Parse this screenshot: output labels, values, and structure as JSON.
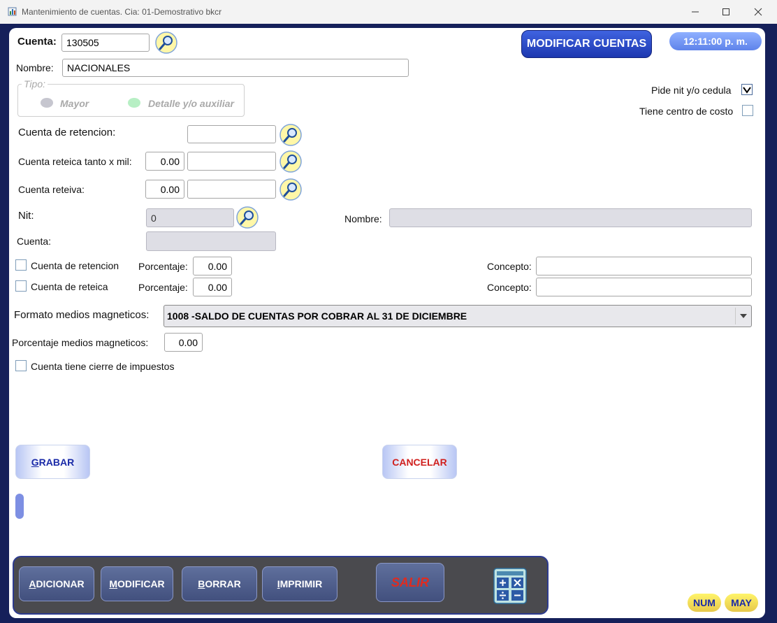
{
  "window": {
    "title": "Mantenimiento de cuentas.  Cia: 01-Demostrativo bkcr",
    "minimize_icon": "minimize-icon",
    "maximize_icon": "maximize-icon",
    "close_icon": "close-icon"
  },
  "header": {
    "mode_badge": "MODIFICAR CUENTAS",
    "clock": "12:11:00 p. m."
  },
  "cuenta": {
    "label": "Cuenta:",
    "value": "130505"
  },
  "nombre": {
    "label": "Nombre:",
    "value": "NACIONALES"
  },
  "tipo": {
    "legend": "Tipo:",
    "options": [
      {
        "label": "Mayor",
        "color": "#c6c6cf"
      },
      {
        "label": "Detalle y/o auxiliar",
        "color": "#b7efc4"
      }
    ]
  },
  "flags": {
    "pide_nit": {
      "label": "Pide nit y/o cedula",
      "checked": true
    },
    "centro_costo": {
      "label": "Tiene centro de costo",
      "checked": false
    }
  },
  "retenciones": {
    "cuenta_retencion": {
      "label": "Cuenta de retencion:",
      "value": ""
    },
    "cuenta_reteica": {
      "label": "Cuenta reteica tanto x mil:",
      "rate": "0.00",
      "value": ""
    },
    "cuenta_reteiva": {
      "label": "Cuenta reteiva:",
      "rate": "0.00",
      "value": ""
    }
  },
  "nit": {
    "label": "Nit:",
    "value": "0",
    "nombre_label": "Nombre:",
    "nombre_value": "",
    "cuenta_label": "Cuenta:",
    "cuenta_value": ""
  },
  "checks": {
    "retencion": {
      "label": "Cuenta de retencion",
      "pct_label": "Porcentaje:",
      "pct": "0.00",
      "concepto_label": "Concepto:",
      "concepto": ""
    },
    "reteica": {
      "label": "Cuenta de reteica",
      "pct_label": "Porcentaje:",
      "pct": "0.00",
      "concepto_label": "Concepto:",
      "concepto": ""
    }
  },
  "medios": {
    "formato_label": "Formato medios magneticos:",
    "formato_value": "1008  -SALDO DE CUENTAS POR COBRAR AL 31 DE DICIEMBRE",
    "porcentaje_label": "Porcentaje medios magneticos:",
    "porcentaje_value": "0.00"
  },
  "cierre": {
    "label": "Cuenta tiene cierre de impuestos"
  },
  "actions": {
    "grabar_first": "G",
    "grabar_rest": "RABAR",
    "cancelar": "CANCELAR"
  },
  "toolbar": {
    "adicionar_first": "A",
    "adicionar_rest": "DICIONAR",
    "modificar_first": "M",
    "modificar_rest": "ODIFICAR",
    "borrar_first": "B",
    "borrar_rest": "ORRAR",
    "imprimir_first": "I",
    "imprimir_rest": "MPRIMIR",
    "salir": "SALIR",
    "calculator_icon": "calculator-icon"
  },
  "status": {
    "num": "NUM",
    "may": "MAY"
  },
  "colors": {
    "accent_blue": "#2a45c8",
    "frame": "#15205a",
    "cancel_red": "#d0201e",
    "action_blue": "#1a2aa8",
    "salir_red": "#e02b1f"
  }
}
